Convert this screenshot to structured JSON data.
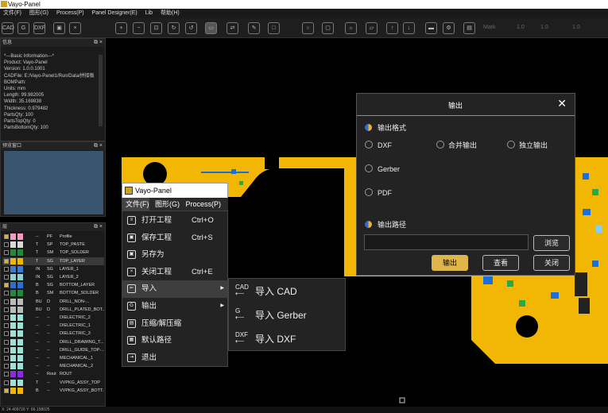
{
  "window": {
    "title": "Vayo-Panel"
  },
  "menu": [
    "文件(F)",
    "图形(G)",
    "Process(P)",
    "Panel Designer(E)",
    "Lib",
    "帮助(H)"
  ],
  "toolbar": {
    "mark_label": "Mark",
    "v1": "1.0",
    "v2": "1.0",
    "v3": "1.0"
  },
  "info_panel": {
    "title": "信息",
    "lines": [
      "*---Basic Information---*",
      "Product: Vayo-Panel",
      "Version: 1.0.0.1001",
      "CADFile: E:/Vayo-Panel1/Run/Data/拼接板",
      "BOMPath:",
      "Units: mm",
      "Length: 99.982005",
      "Width: 35.169838",
      "Thickness: 0.979482",
      "PartsQty: 100",
      "PartsTopQty: 0",
      "PartsBottomQty: 100"
    ]
  },
  "preview_panel": {
    "title": "预览窗口"
  },
  "layers_panel": {
    "title": "层",
    "rows": [
      {
        "checked": true,
        "c1": "#f59ac0",
        "c2": "#f59ac0",
        "a": "--",
        "b": "PF",
        "name": "Profile"
      },
      {
        "checked": false,
        "c1": "#d9d9d9",
        "c2": "#d9d9d9",
        "a": "T",
        "b": "SP",
        "name": "TOP_PASTE"
      },
      {
        "checked": false,
        "c1": "#1f8a3a",
        "c2": "#1f8a3a",
        "a": "T",
        "b": "SM",
        "name": "TOP_SOLDER"
      },
      {
        "checked": true,
        "c1": "#f2b705",
        "c2": "#f2b705",
        "a": "T",
        "b": "SG",
        "name": "TOP_LAYER",
        "selected": true
      },
      {
        "checked": false,
        "c1": "#3a7bd5",
        "c2": "#3a7bd5",
        "a": "IN",
        "b": "SG",
        "name": "LAYER_1"
      },
      {
        "checked": false,
        "c1": "#8fd0d0",
        "c2": "#8fd0d0",
        "a": "IN",
        "b": "SG",
        "name": "LAYER_2"
      },
      {
        "checked": true,
        "c1": "#2c6fd1",
        "c2": "#2c6fd1",
        "a": "B",
        "b": "SG",
        "name": "BOTTOM_LAYER"
      },
      {
        "checked": false,
        "c1": "#1f8a3a",
        "c2": "#1f8a3a",
        "a": "B",
        "b": "SM",
        "name": "BOTTOM_SOLDER"
      },
      {
        "checked": false,
        "c1": "#bbbbbb",
        "c2": "#bbbbbb",
        "a": "BU",
        "b": "D",
        "name": "DRILL_NON-..."
      },
      {
        "checked": false,
        "c1": "#bbbbbb",
        "c2": "#bbbbbb",
        "a": "BU",
        "b": "D",
        "name": "DRILL_PLATED_BOT..."
      },
      {
        "checked": false,
        "c1": "#9fe0d8",
        "c2": "#9fe0d8",
        "a": "--",
        "b": "--",
        "name": "DIELECTRIC_2"
      },
      {
        "checked": false,
        "c1": "#9fe0d8",
        "c2": "#9fe0d8",
        "a": "--",
        "b": "--",
        "name": "DIELECTRIC_1"
      },
      {
        "checked": false,
        "c1": "#9fe0d8",
        "c2": "#9fe0d8",
        "a": "--",
        "b": "--",
        "name": "DIELECTRIC_3"
      },
      {
        "checked": false,
        "c1": "#9fe0d8",
        "c2": "#9fe0d8",
        "a": "--",
        "b": "--",
        "name": "DRILL_DRAWING_T..."
      },
      {
        "checked": false,
        "c1": "#9fe0d8",
        "c2": "#9fe0d8",
        "a": "--",
        "b": "--",
        "name": "DRILL_GUIDE_TOP-..."
      },
      {
        "checked": false,
        "c1": "#9fe0d8",
        "c2": "#9fe0d8",
        "a": "--",
        "b": "--",
        "name": "MECHANICAL_1"
      },
      {
        "checked": false,
        "c1": "#9fe0d8",
        "c2": "#9fe0d8",
        "a": "--",
        "b": "--",
        "name": "MECHANICAL_2"
      },
      {
        "checked": false,
        "c1": "#8a2be2",
        "c2": "#8a2be2",
        "a": "--",
        "b": "Rout",
        "name": "ROUT"
      },
      {
        "checked": false,
        "c1": "#9fe0d8",
        "c2": "#9fe0d8",
        "a": "T",
        "b": "--",
        "name": "VVPKG_ASSY_TOP"
      },
      {
        "checked": true,
        "c1": "#f2b705",
        "c2": "#f2b705",
        "a": "B",
        "b": "--",
        "name": "VVPKG_ASSY_BOTT..."
      }
    ]
  },
  "status": {
    "coords": "X: 24.409726  Y: 66.158025"
  },
  "context_window": {
    "title": "Vayo-Panel",
    "menubar": [
      "文件(F)",
      "图形(G)",
      "Process(P)"
    ]
  },
  "file_menu": [
    {
      "label": "打开工程",
      "shortcut": "Ctrl+O",
      "icon": "open-project-icon",
      "glyph": "≡"
    },
    {
      "label": "保存工程",
      "shortcut": "Ctrl+S",
      "icon": "save-icon",
      "glyph": "▣"
    },
    {
      "label": "另存为",
      "shortcut": "",
      "icon": "save-as-icon",
      "glyph": "▣"
    },
    {
      "label": "关闭工程",
      "shortcut": "Ctrl+E",
      "icon": "close-project-icon",
      "glyph": "×"
    },
    {
      "label": "导入",
      "shortcut": "",
      "icon": "import-cad-icon",
      "glyph": "⇐",
      "submenu": true,
      "highlighted": true
    },
    {
      "label": "输出",
      "shortcut": "",
      "icon": "export-gerber-icon",
      "glyph": "G",
      "submenu": true
    },
    {
      "label": "压缩/解压缩",
      "shortcut": "",
      "icon": "compress-icon",
      "glyph": "▤"
    },
    {
      "label": "默认路径",
      "shortcut": "",
      "icon": "default-path-icon",
      "glyph": "▦"
    },
    {
      "label": "退出",
      "shortcut": "",
      "icon": "exit-icon",
      "glyph": "⇥"
    }
  ],
  "import_submenu": [
    {
      "label": "导入 CAD",
      "icon": "CAD"
    },
    {
      "label": "导入 Gerber",
      "icon": "G"
    },
    {
      "label": "导入 DXF",
      "icon": "DXF"
    }
  ],
  "dialog": {
    "title": "输出",
    "format_label": "输出格式",
    "options": {
      "dxf": "DXF",
      "merge": "合并输出",
      "separate": "独立输出",
      "gerber": "Gerber",
      "pdf": "PDF"
    },
    "path_label": "输出路径",
    "path_value": "",
    "browse": "浏览",
    "export": "输出",
    "view": "查看",
    "close": "关闭"
  },
  "colors": {
    "accent": "#e0b54a",
    "pcb": "#f2b705"
  }
}
